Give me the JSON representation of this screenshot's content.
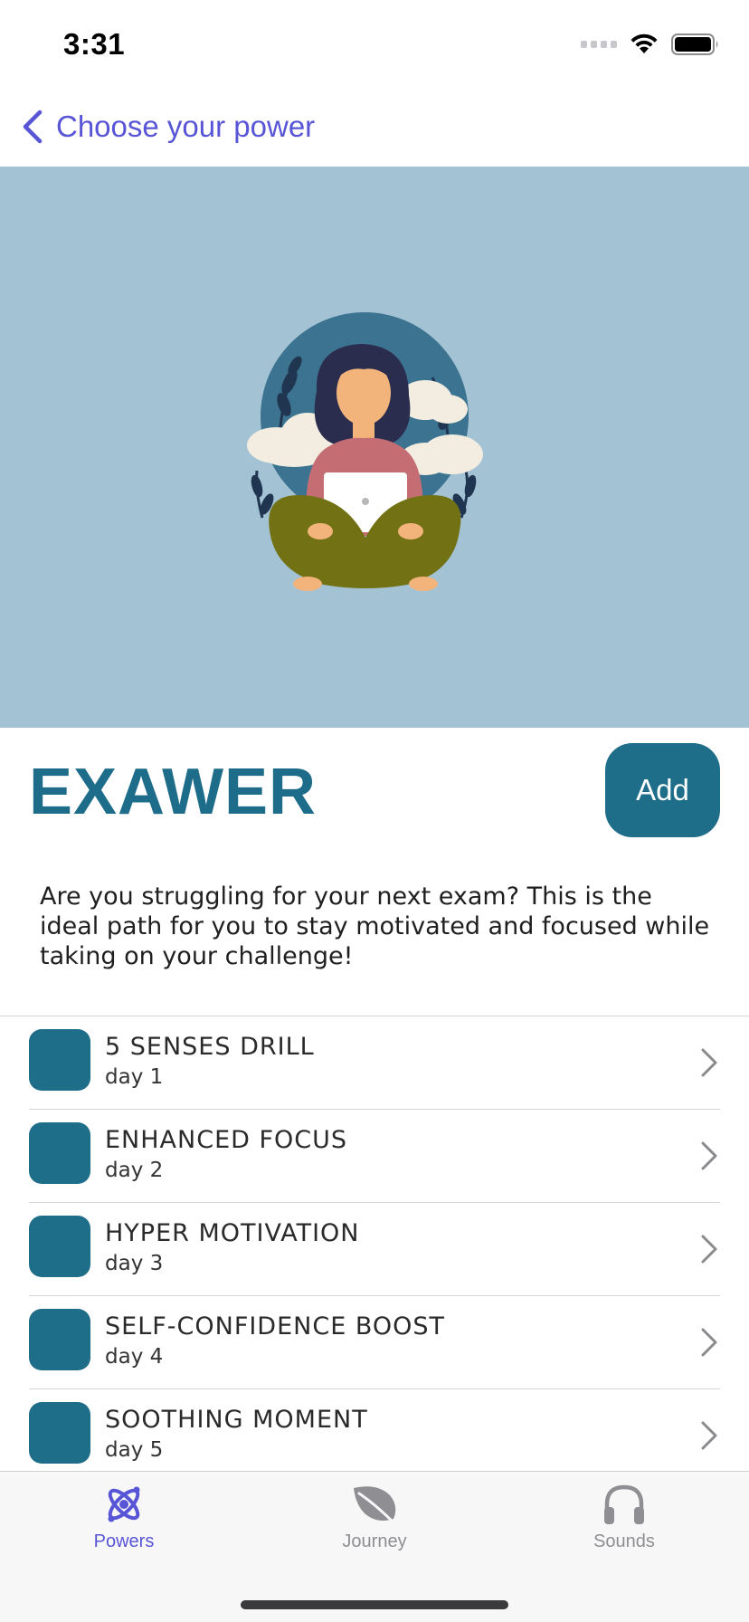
{
  "status_bar": {
    "time": "3:31"
  },
  "nav": {
    "back_label": "Choose your power"
  },
  "power": {
    "title": "EXAWER",
    "add_label": "Add",
    "description": "Are you struggling for your next exam? This is the ideal path for you to stay motivated and focused while taking on your challenge!"
  },
  "sessions": [
    {
      "title": "5 SENSES DRILL",
      "day": "day 1"
    },
    {
      "title": "ENHANCED FOCUS",
      "day": "day 2"
    },
    {
      "title": "HYPER MOTIVATION",
      "day": "day 3"
    },
    {
      "title": "SELF-CONFIDENCE BOOST",
      "day": "day 4"
    },
    {
      "title": "SOOTHING MOMENT",
      "day": "day 5"
    }
  ],
  "tabs": [
    {
      "label": "Powers",
      "icon": "atom-icon",
      "active": true
    },
    {
      "label": "Journey",
      "icon": "leaf-icon",
      "active": false
    },
    {
      "label": "Sounds",
      "icon": "headphones-icon",
      "active": false
    }
  ],
  "colors": {
    "accent": "#5856d6",
    "brand": "#1e6d89",
    "hero_bg": "#a3c2d3"
  }
}
